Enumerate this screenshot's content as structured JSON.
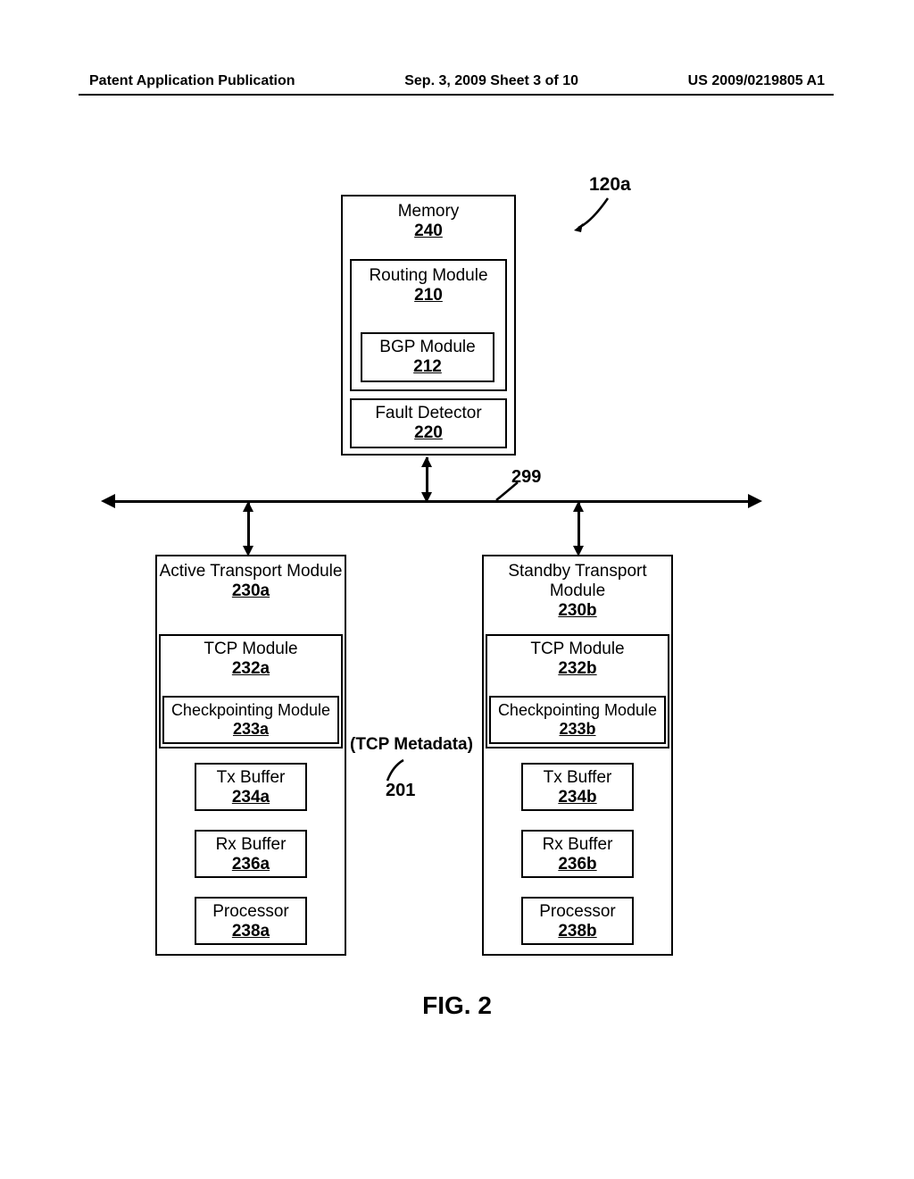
{
  "header": {
    "left": "Patent Application Publication",
    "mid": "Sep. 3, 2009  Sheet 3 of 10",
    "right": "US 2009/0219805 A1"
  },
  "refs": {
    "r120a": "120a",
    "r299": "299",
    "r201": "201"
  },
  "memory": {
    "title": "Memory",
    "ref": "240"
  },
  "routing": {
    "title": "Routing Module",
    "ref": "210"
  },
  "bgp": {
    "title": "BGP Module",
    "ref": "212"
  },
  "fault": {
    "title": "Fault Detector",
    "ref": "220"
  },
  "tm_a": {
    "title": "Active Transport Module",
    "ref": "230a"
  },
  "tm_b": {
    "title": "Standby Transport Module",
    "ref": "230b"
  },
  "tcp_a": {
    "title": "TCP Module",
    "ref": "232a"
  },
  "tcp_b": {
    "title": "TCP Module",
    "ref": "232b"
  },
  "chk_a": {
    "title": "Checkpointing Module",
    "ref": "233a"
  },
  "chk_b": {
    "title": "Checkpointing Module",
    "ref": "233b"
  },
  "tx_a": {
    "title": "Tx Buffer",
    "ref": "234a"
  },
  "tx_b": {
    "title": "Tx Buffer",
    "ref": "234b"
  },
  "rx_a": {
    "title": "Rx Buffer",
    "ref": "236a"
  },
  "rx_b": {
    "title": "Rx Buffer",
    "ref": "236b"
  },
  "pr_a": {
    "title": "Processor",
    "ref": "238a"
  },
  "pr_b": {
    "title": "Processor",
    "ref": "238b"
  },
  "meta": {
    "label": "(TCP Metadata)"
  },
  "figure": {
    "caption": "FIG. 2"
  }
}
